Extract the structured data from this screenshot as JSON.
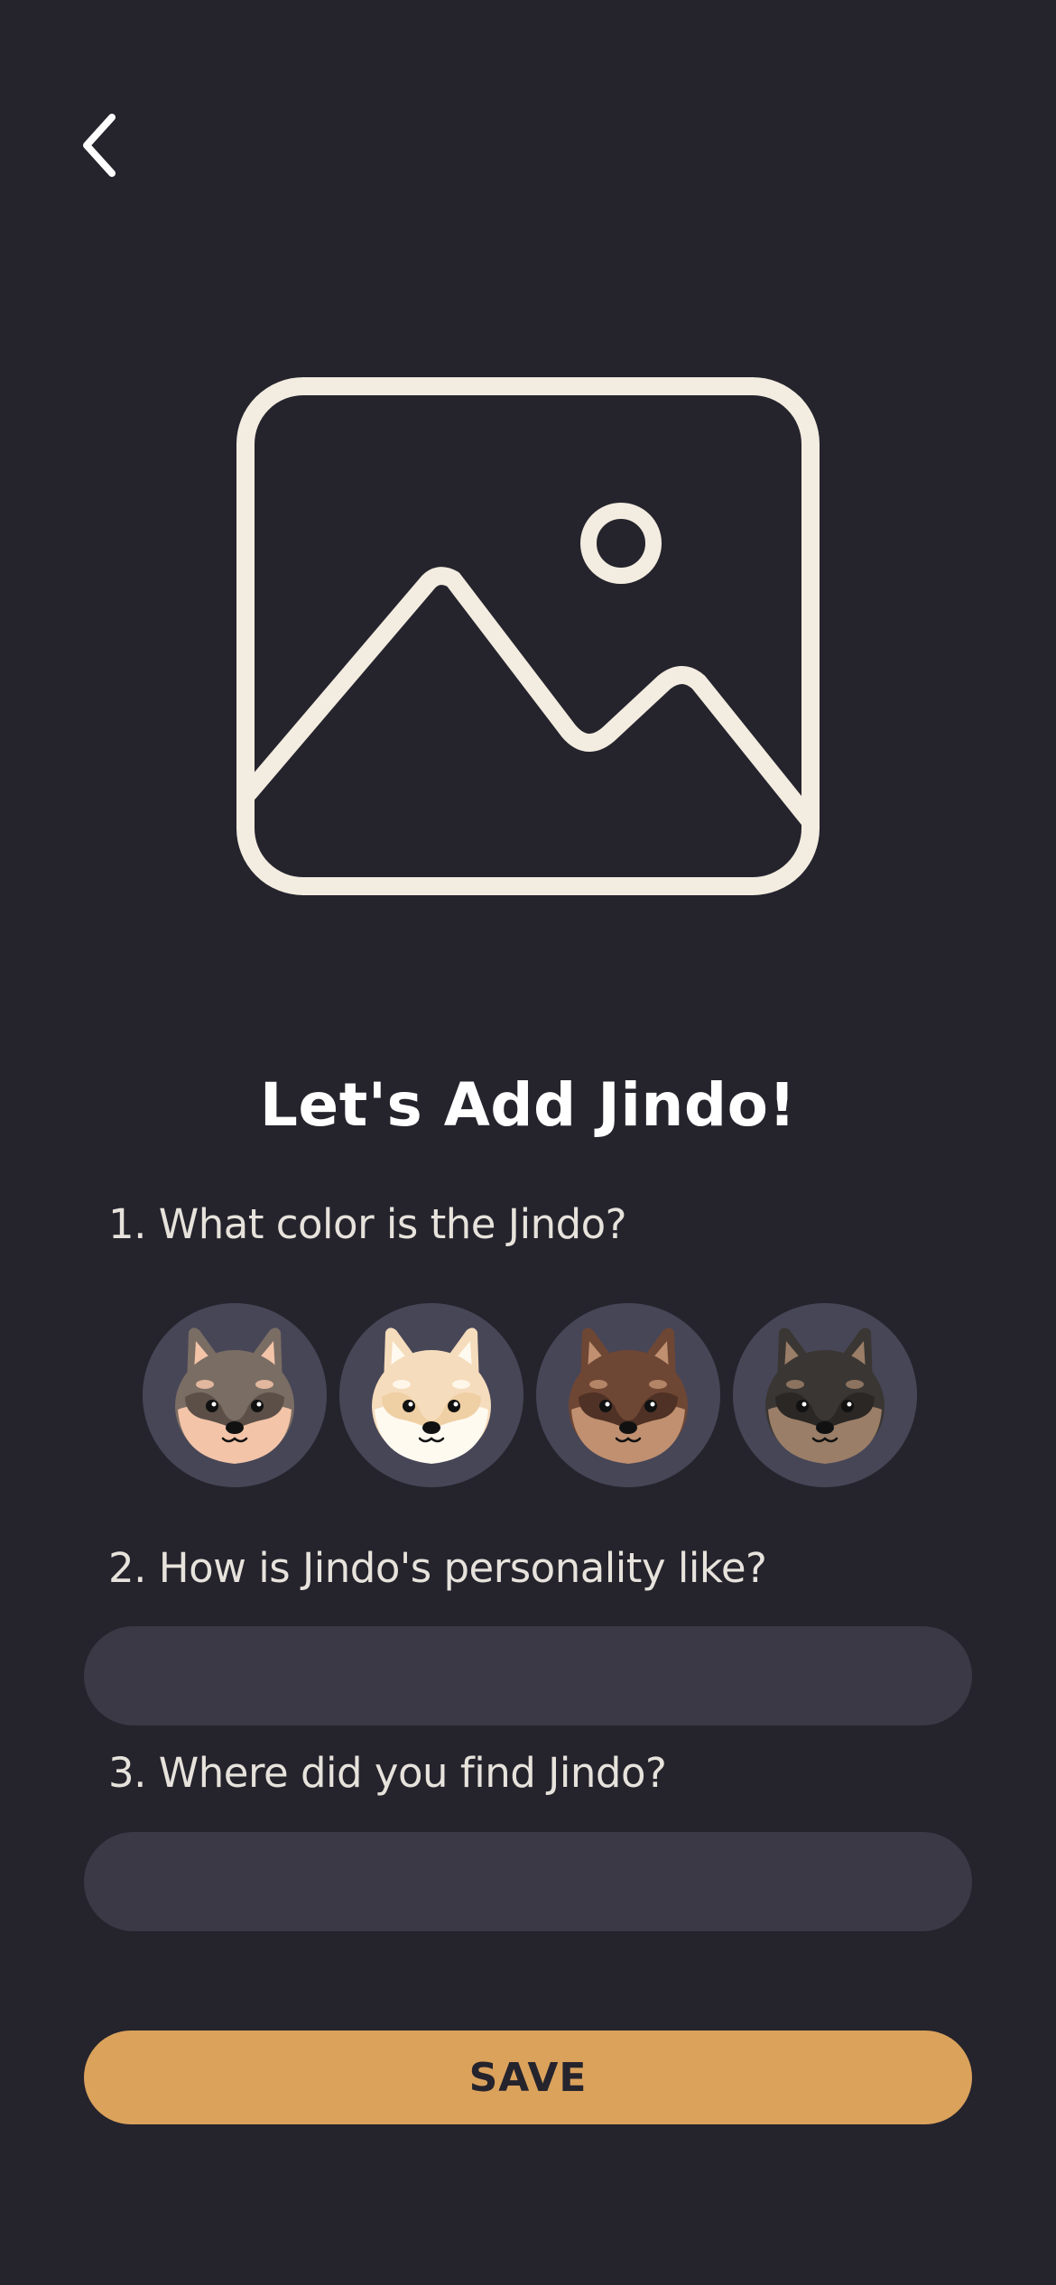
{
  "header": {
    "back_icon": "chevron-left-icon"
  },
  "placeholder": {
    "icon": "image-icon",
    "stroke_color": "#f3ece0"
  },
  "form": {
    "title": "Let's Add Jindo!",
    "q1_label": "1. What color is the Jindo?",
    "colors": [
      {
        "name": "grey",
        "ear": "#7a6d64",
        "inner_ear": "#f3c4a8",
        "head": "#7a6d64",
        "face": "#f3c4a8",
        "mask": "#5b4f48"
      },
      {
        "name": "cream",
        "ear": "#f5dcbc",
        "inner_ear": "#fffaf0",
        "head": "#f5dcbc",
        "face": "#fffaf0",
        "mask": "#efcfa4"
      },
      {
        "name": "brown",
        "ear": "#6e4634",
        "inner_ear": "#c09070",
        "head": "#6e4634",
        "face": "#c09070",
        "mask": "#4f3125"
      },
      {
        "name": "black",
        "ear": "#3a3633",
        "inner_ear": "#9a7e68",
        "head": "#3a3633",
        "face": "#9a7e68",
        "mask": "#2a2725"
      }
    ],
    "q2_label": "2. How is Jindo's personality like?",
    "q2_value": "",
    "q3_label": "3. Where did you find Jindo?",
    "q3_value": "",
    "save_label": "SAVE"
  },
  "theme": {
    "background": "#25242d",
    "input_bg": "#3a3945",
    "accent": "#dba25c"
  }
}
